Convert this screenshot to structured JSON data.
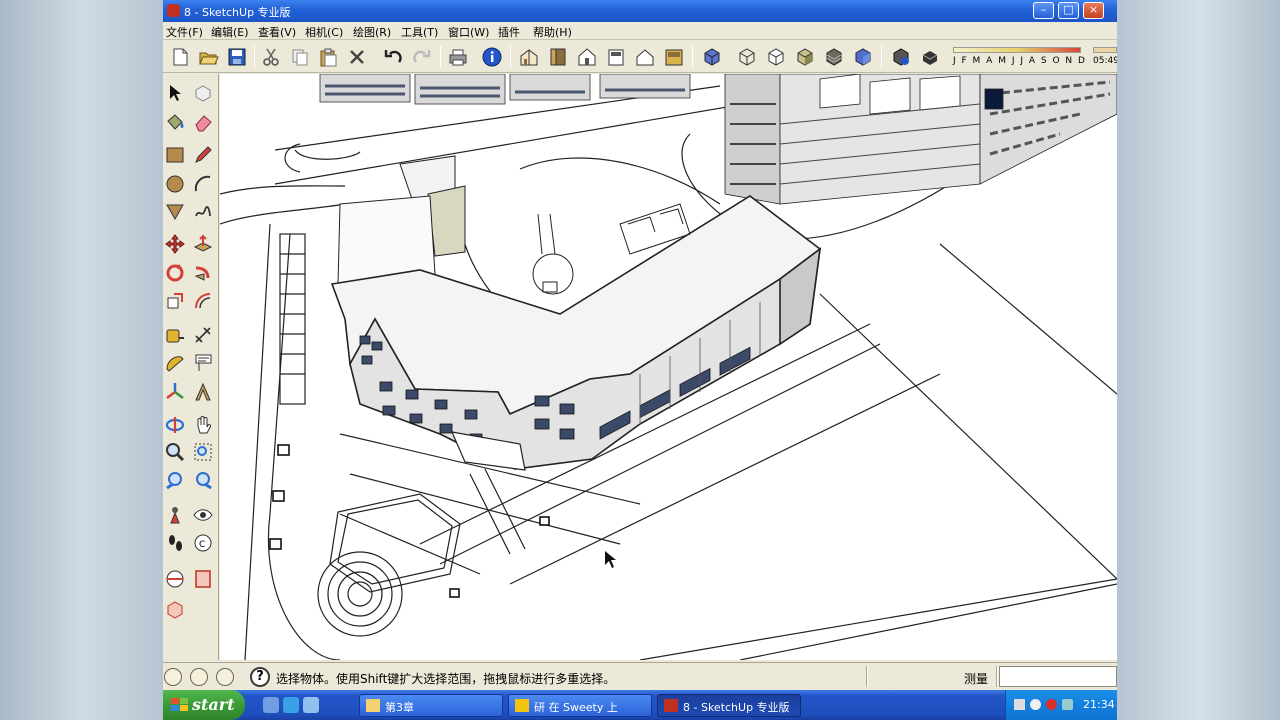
{
  "window": {
    "title": "8 - SketchUp 专业版",
    "minimize": "–",
    "maximize": "□",
    "close": "×"
  },
  "menu": [
    {
      "label": "文件(F)"
    },
    {
      "label": "编辑(E)"
    },
    {
      "label": "查看(V)"
    },
    {
      "label": "相机(C)"
    },
    {
      "label": "绘图(R)"
    },
    {
      "label": "工具(T)"
    },
    {
      "label": "窗口(W)"
    },
    {
      "label": "插件"
    },
    {
      "label": "帮助(H)"
    }
  ],
  "toolbar": {
    "months": "J F M A M J J A S O N D",
    "time": "05:49"
  },
  "status": {
    "hint": "选择物体。使用Shift键扩大选择范围，拖拽鼠标进行多重选择。",
    "measure_label": "测量",
    "measure_value": "",
    "help": "?"
  },
  "taskbar": {
    "start": "start",
    "tasks": [
      {
        "label": "第3章"
      },
      {
        "label": "研 在 Sweety 上"
      },
      {
        "label": "8 - SketchUp 专业版"
      }
    ],
    "clock": "21:34"
  },
  "colors": {
    "titlebar": "#2464d9",
    "taskbar": "#2455c8",
    "start": "#3b9a36",
    "chrome": "#ece9d8",
    "viewport": "#ffffff"
  }
}
